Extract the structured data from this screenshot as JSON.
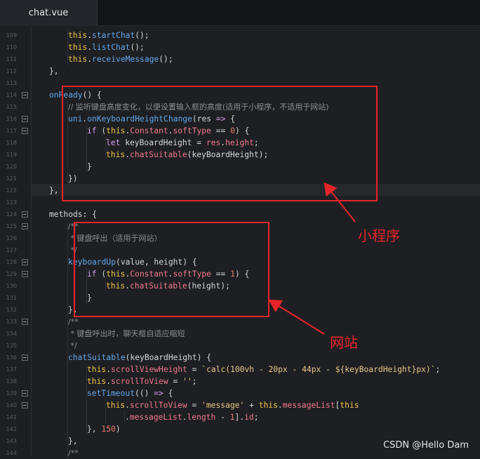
{
  "tab": {
    "title": "chat.vue"
  },
  "lines": [
    {
      "n": "109",
      "fold": false,
      "indent": 2,
      "tokens": [
        [
          "this",
          "this"
        ],
        [
          "plain",
          "."
        ],
        [
          "fn",
          "startChat"
        ],
        [
          "plain",
          "();"
        ]
      ]
    },
    {
      "n": "110",
      "fold": false,
      "indent": 2,
      "tokens": [
        [
          "this",
          "this"
        ],
        [
          "plain",
          "."
        ],
        [
          "fn",
          "listChat"
        ],
        [
          "plain",
          "();"
        ]
      ]
    },
    {
      "n": "111",
      "fold": false,
      "indent": 2,
      "tokens": [
        [
          "this",
          "this"
        ],
        [
          "plain",
          "."
        ],
        [
          "fn",
          "receiveMessage"
        ],
        [
          "plain",
          "();"
        ]
      ]
    },
    {
      "n": "112",
      "fold": false,
      "indent": 1,
      "tokens": [
        [
          "plain",
          "},"
        ]
      ]
    },
    {
      "n": "113",
      "fold": false,
      "indent": 0,
      "tokens": []
    },
    {
      "n": "114",
      "fold": true,
      "indent": 1,
      "tokens": [
        [
          "fn",
          "onReady"
        ],
        [
          "plain",
          "() {"
        ]
      ]
    },
    {
      "n": "115",
      "fold": false,
      "indent": 2,
      "tokens": [
        [
          "cmt",
          "// 监听键盘高度变化，以便设置输入框的高度(适用于小程序，不适用于网站)"
        ]
      ]
    },
    {
      "n": "116",
      "fold": true,
      "indent": 2,
      "tokens": [
        [
          "fn",
          "uni"
        ],
        [
          "plain",
          "."
        ],
        [
          "fn",
          "onKeyboardHeightChange"
        ],
        [
          "plain",
          "(res "
        ],
        [
          "kw",
          "=>"
        ],
        [
          "plain",
          " {"
        ]
      ]
    },
    {
      "n": "117",
      "fold": true,
      "indent": 3,
      "tokens": [
        [
          "kw",
          "if"
        ],
        [
          "plain",
          " ("
        ],
        [
          "this",
          "this"
        ],
        [
          "plain",
          "."
        ],
        [
          "prop",
          "Constant"
        ],
        [
          "plain",
          "."
        ],
        [
          "prop",
          "softType"
        ],
        [
          "plain",
          " == "
        ],
        [
          "num",
          "0"
        ],
        [
          "plain",
          ") {"
        ]
      ]
    },
    {
      "n": "118",
      "fold": false,
      "indent": 4,
      "tokens": [
        [
          "kw",
          "let"
        ],
        [
          "plain",
          " keyBoardHeight = "
        ],
        [
          "prop",
          "res"
        ],
        [
          "plain",
          "."
        ],
        [
          "prop",
          "height"
        ],
        [
          "plain",
          ";"
        ]
      ]
    },
    {
      "n": "119",
      "fold": false,
      "indent": 4,
      "tokens": [
        [
          "this",
          "this"
        ],
        [
          "plain",
          "."
        ],
        [
          "prop",
          "chatSuitable"
        ],
        [
          "plain",
          "(keyBoardHeight);"
        ]
      ]
    },
    {
      "n": "120",
      "fold": false,
      "indent": 3,
      "tokens": [
        [
          "plain",
          "}"
        ]
      ]
    },
    {
      "n": "121",
      "fold": false,
      "indent": 2,
      "tokens": [
        [
          "plain",
          "})"
        ]
      ]
    },
    {
      "n": "122",
      "fold": false,
      "indent": 1,
      "tokens": [
        [
          "plain",
          "},"
        ]
      ]
    },
    {
      "n": "123",
      "fold": false,
      "indent": 0,
      "tokens": []
    },
    {
      "n": "124",
      "fold": true,
      "indent": 1,
      "tokens": [
        [
          "plain",
          "methods: {"
        ]
      ]
    },
    {
      "n": "125",
      "fold": true,
      "indent": 2,
      "tokens": [
        [
          "cmt",
          "/**"
        ]
      ]
    },
    {
      "n": "126",
      "fold": false,
      "indent": 2,
      "tokens": [
        [
          "cmt",
          " * 键盘呼出（适用于网站）"
        ]
      ]
    },
    {
      "n": "127",
      "fold": false,
      "indent": 2,
      "tokens": [
        [
          "cmt",
          " */"
        ]
      ]
    },
    {
      "n": "128",
      "fold": true,
      "indent": 2,
      "tokens": [
        [
          "fn",
          "keyboardUp"
        ],
        [
          "plain",
          "(value, height) {"
        ]
      ]
    },
    {
      "n": "129",
      "fold": true,
      "indent": 3,
      "tokens": [
        [
          "kw",
          "if"
        ],
        [
          "plain",
          " ("
        ],
        [
          "this",
          "this"
        ],
        [
          "plain",
          "."
        ],
        [
          "prop",
          "Constant"
        ],
        [
          "plain",
          "."
        ],
        [
          "prop",
          "softType"
        ],
        [
          "plain",
          " == "
        ],
        [
          "num",
          "1"
        ],
        [
          "plain",
          ") {"
        ]
      ]
    },
    {
      "n": "130",
      "fold": false,
      "indent": 4,
      "tokens": [
        [
          "this",
          "this"
        ],
        [
          "plain",
          "."
        ],
        [
          "prop",
          "chatSuitable"
        ],
        [
          "plain",
          "(height);"
        ]
      ]
    },
    {
      "n": "131",
      "fold": false,
      "indent": 3,
      "tokens": [
        [
          "plain",
          "}"
        ]
      ]
    },
    {
      "n": "132",
      "fold": false,
      "indent": 2,
      "tokens": [
        [
          "plain",
          "},"
        ]
      ]
    },
    {
      "n": "133",
      "fold": true,
      "indent": 2,
      "tokens": [
        [
          "cmt",
          "/**"
        ]
      ]
    },
    {
      "n": "134",
      "fold": false,
      "indent": 2,
      "tokens": [
        [
          "cmt",
          " * 键盘呼出时，聊天框自适应缩短"
        ]
      ]
    },
    {
      "n": "135",
      "fold": false,
      "indent": 2,
      "tokens": [
        [
          "cmt",
          " */"
        ]
      ]
    },
    {
      "n": "136",
      "fold": true,
      "indent": 2,
      "tokens": [
        [
          "fn",
          "chatSuitable"
        ],
        [
          "plain",
          "(keyBoardHeight) {"
        ]
      ]
    },
    {
      "n": "137",
      "fold": false,
      "indent": 3,
      "tokens": [
        [
          "this",
          "this"
        ],
        [
          "plain",
          "."
        ],
        [
          "prop",
          "scrollViewHeight"
        ],
        [
          "plain",
          " = "
        ],
        [
          "str",
          "`calc(100vh - 20px - 44px - ${keyBoardHeight}px)`"
        ],
        [
          "plain",
          ";"
        ]
      ]
    },
    {
      "n": "138",
      "fold": false,
      "indent": 3,
      "tokens": [
        [
          "this",
          "this"
        ],
        [
          "plain",
          "."
        ],
        [
          "prop",
          "scrollToView"
        ],
        [
          "plain",
          " = "
        ],
        [
          "str",
          "''"
        ],
        [
          "plain",
          ";"
        ]
      ]
    },
    {
      "n": "139",
      "fold": true,
      "indent": 3,
      "tokens": [
        [
          "fn",
          "setTimeout"
        ],
        [
          "plain",
          "(() "
        ],
        [
          "kw",
          "=>"
        ],
        [
          "plain",
          " {"
        ]
      ]
    },
    {
      "n": "140",
      "fold": true,
      "indent": 4,
      "tokens": [
        [
          "this",
          "this"
        ],
        [
          "plain",
          "."
        ],
        [
          "prop",
          "scrollToView"
        ],
        [
          "plain",
          " = "
        ],
        [
          "str",
          "'message'"
        ],
        [
          "plain",
          " + "
        ],
        [
          "this",
          "this"
        ],
        [
          "plain",
          "."
        ],
        [
          "prop",
          "messageList"
        ],
        [
          "plain",
          "["
        ],
        [
          "this",
          "this"
        ]
      ]
    },
    {
      "n": "141",
      "fold": false,
      "indent": 5,
      "tokens": [
        [
          "plain",
          "."
        ],
        [
          "prop",
          "messageList"
        ],
        [
          "plain",
          "."
        ],
        [
          "prop",
          "length"
        ],
        [
          "plain",
          " - "
        ],
        [
          "num",
          "1"
        ],
        [
          "plain",
          "]."
        ],
        [
          "prop",
          "id"
        ],
        [
          "plain",
          ";"
        ]
      ]
    },
    {
      "n": "142",
      "fold": false,
      "indent": 3,
      "tokens": [
        [
          "plain",
          "}, "
        ],
        [
          "num",
          "150"
        ],
        [
          "plain",
          ")"
        ]
      ]
    },
    {
      "n": "143",
      "fold": false,
      "indent": 2,
      "tokens": [
        [
          "plain",
          "},"
        ]
      ]
    },
    {
      "n": "144",
      "fold": false,
      "indent": 2,
      "tokens": [
        [
          "cmt",
          "/**"
        ]
      ]
    }
  ],
  "annotations": {
    "miniprogram_label": "小程序",
    "website_label": "网站",
    "color": "#e8252a"
  },
  "watermark": "CSDN @Hello Dam"
}
